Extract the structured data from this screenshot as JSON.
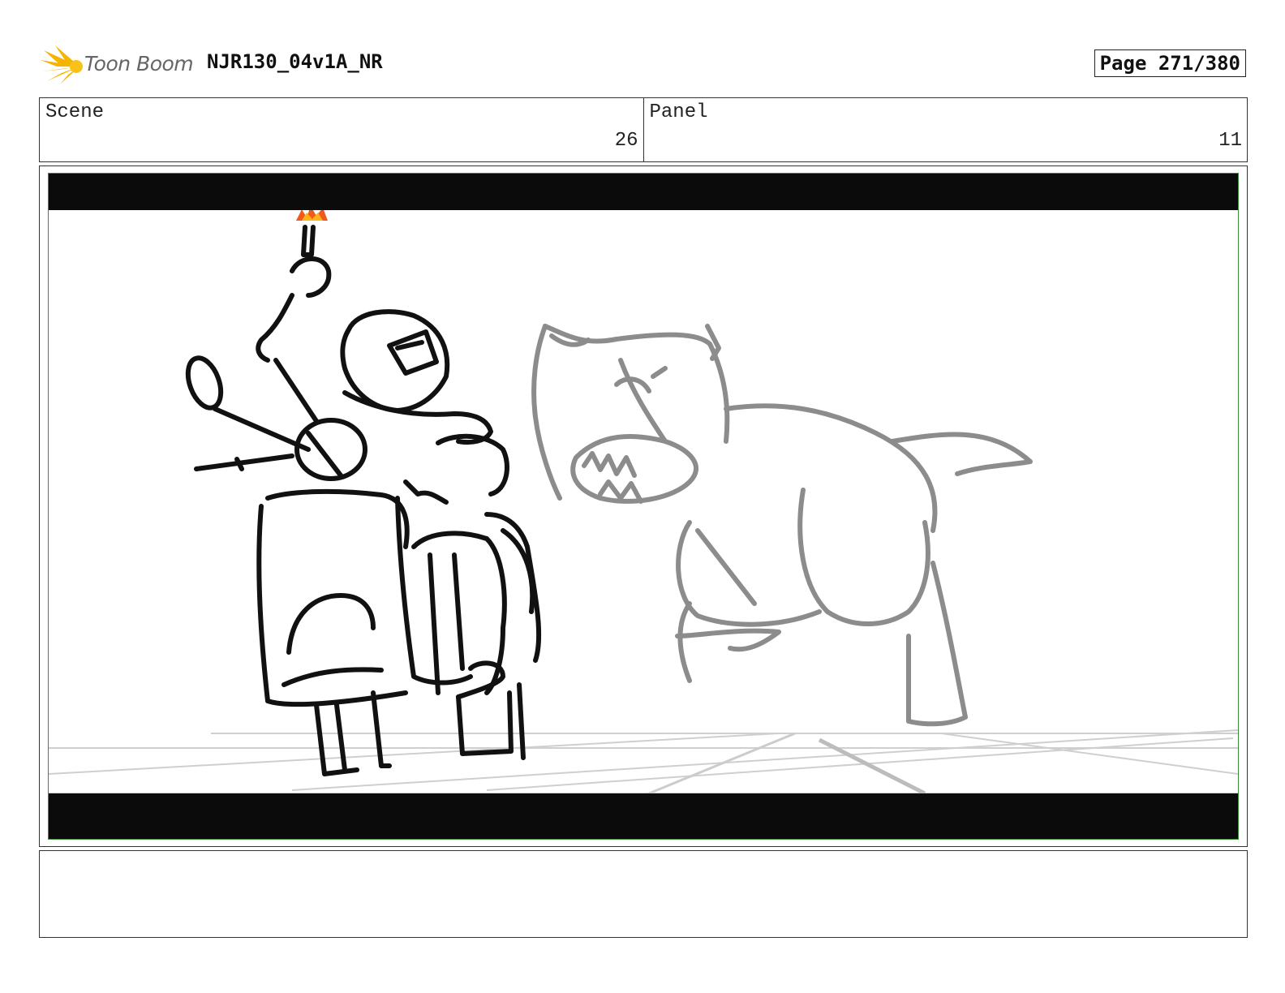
{
  "header": {
    "logo_text": "Toon Boom",
    "title": "NJR130_04v1A_NR",
    "page": "Page 271/380"
  },
  "scene": {
    "label": "Scene",
    "value": "26"
  },
  "panel": {
    "label": "Panel",
    "value": "11"
  },
  "notes": {
    "text": ""
  },
  "colors": {
    "frame_border": "#3a8a3a",
    "letterbox": "#0b0b0b",
    "flame": "#f05a1a"
  }
}
